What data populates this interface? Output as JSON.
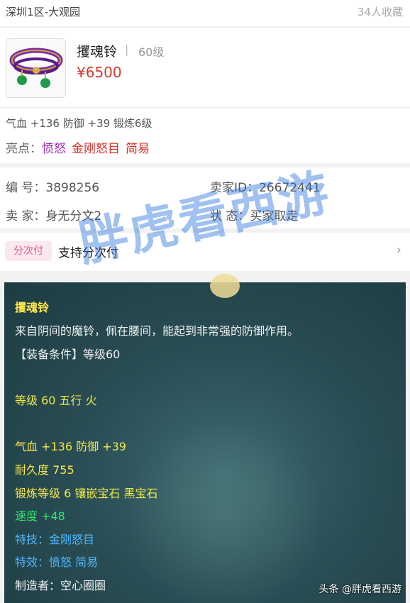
{
  "header": {
    "server": "深圳1区-大观园",
    "favorites": "34人收藏"
  },
  "item": {
    "name": "攫魂铃",
    "separator": "|",
    "level": "60级",
    "price": "¥6500"
  },
  "attributes": {
    "line": "气血 +136 防御 +39 锻炼6级",
    "highlight_label": "亮点：",
    "highlights": [
      "愤怒",
      "金刚怒目",
      "简易"
    ]
  },
  "info": {
    "number": "编  号：3898256",
    "seller_id": "卖家ID：26672441",
    "seller": "卖  家：身无分文2",
    "status": "状  态：买家取走"
  },
  "installment": {
    "badge": "分次付",
    "text": "支持分次付",
    "chevron": "›"
  },
  "tooltip": {
    "title": "攫魂铃",
    "desc": "来自阴间的魔铃，佩在腰间，能起到非常强的防御作用。",
    "requirement": "【装备条件】等级60",
    "level_element": "等级 60  五行 火",
    "stats": "气血 +136 防御 +39",
    "durability": "耐久度 755",
    "forge": "锻炼等级 6  镶嵌宝石 黑宝石",
    "speed": "速度 +48",
    "skill": "特技：金刚怒目",
    "effect": "特效：愤怒 简易",
    "maker": "制造者：空心圈圈"
  },
  "watermark": "胖虎看西游",
  "credit": "头条 @胖虎看西游"
}
